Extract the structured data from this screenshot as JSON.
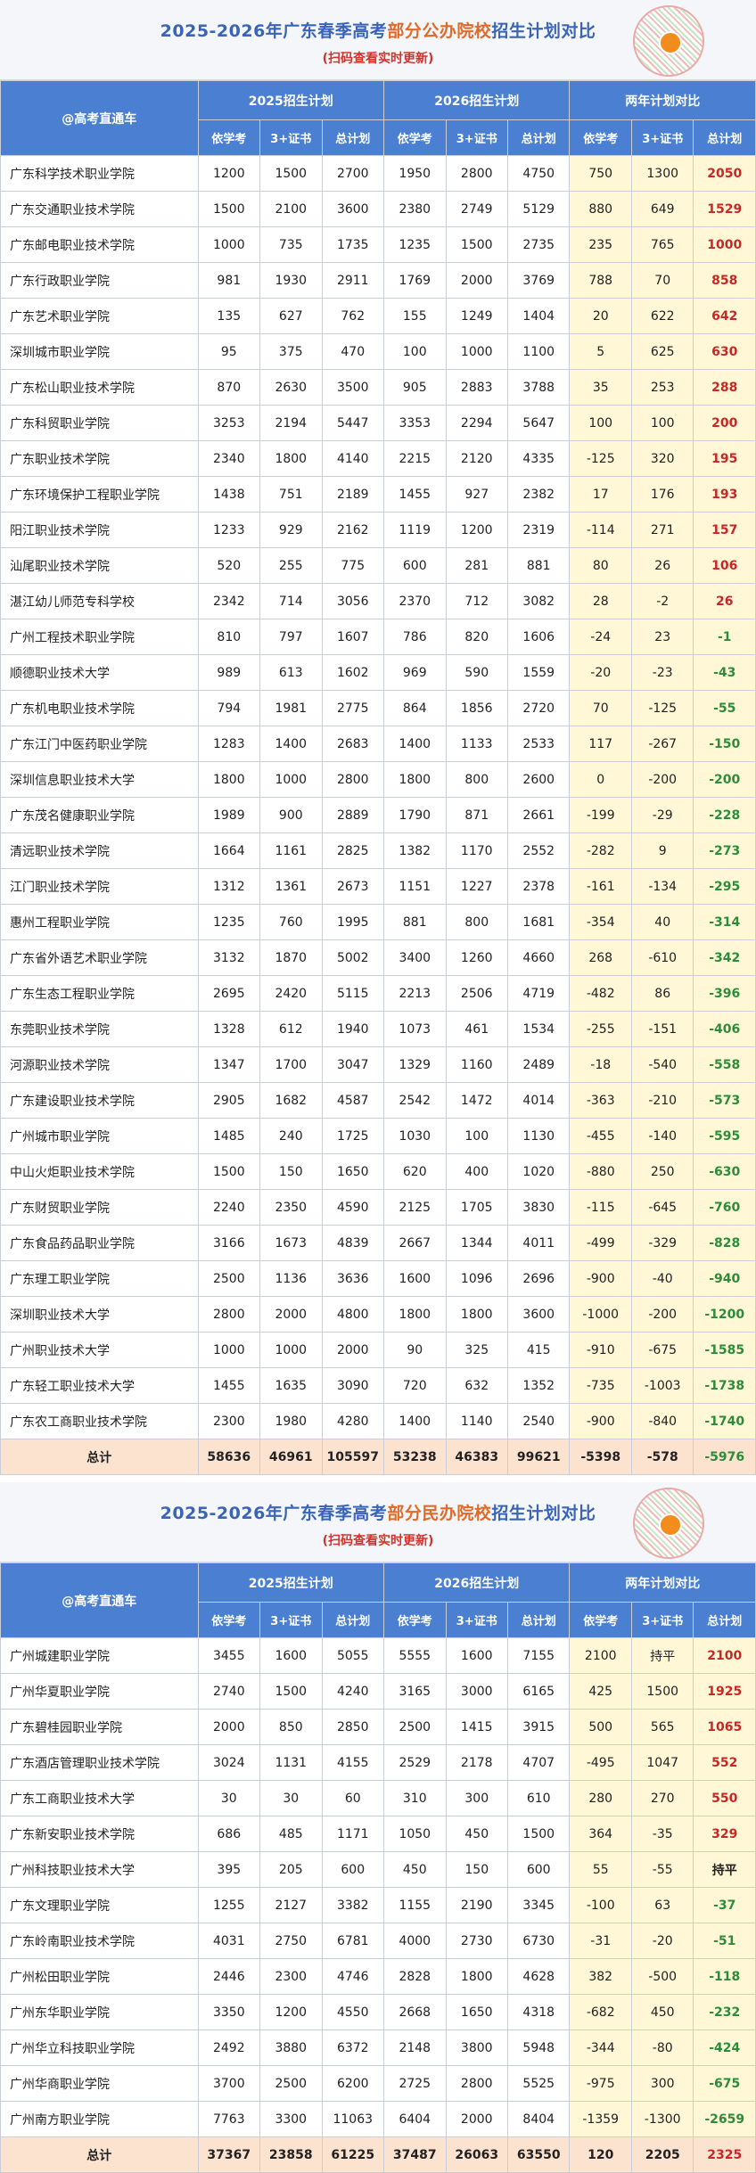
{
  "public": {
    "title_part1": "2025-2026年广东春季高考",
    "title_highlight": "部分公办院校",
    "title_part2": "招生计划对比",
    "subtitle": "(扫码查看实时更新)",
    "header": {
      "corner": "@高考直通车",
      "group_2025": "2025招生计划",
      "group_2026": "2026招生计划",
      "group_cmp": "两年计划对比",
      "sub": [
        "依学考",
        "3+证书",
        "总计划",
        "依学考",
        "3+证书",
        "总计划",
        "依学考",
        "3+证书",
        "总计划"
      ]
    },
    "rows": [
      {
        "name": "广东科学技术职业学院",
        "v": [
          "1200",
          "1500",
          "2700",
          "1950",
          "2800",
          "4750",
          "750",
          "1300",
          "2050"
        ]
      },
      {
        "name": "广东交通职业技术学院",
        "v": [
          "1500",
          "2100",
          "3600",
          "2380",
          "2749",
          "5129",
          "880",
          "649",
          "1529"
        ]
      },
      {
        "name": "广东邮电职业技术学院",
        "v": [
          "1000",
          "735",
          "1735",
          "1235",
          "1500",
          "2735",
          "235",
          "765",
          "1000"
        ]
      },
      {
        "name": "广东行政职业学院",
        "v": [
          "981",
          "1930",
          "2911",
          "1769",
          "2000",
          "3769",
          "788",
          "70",
          "858"
        ]
      },
      {
        "name": "广东艺术职业学院",
        "v": [
          "135",
          "627",
          "762",
          "155",
          "1249",
          "1404",
          "20",
          "622",
          "642"
        ]
      },
      {
        "name": "深圳城市职业学院",
        "v": [
          "95",
          "375",
          "470",
          "100",
          "1000",
          "1100",
          "5",
          "625",
          "630"
        ]
      },
      {
        "name": "广东松山职业技术学院",
        "v": [
          "870",
          "2630",
          "3500",
          "905",
          "2883",
          "3788",
          "35",
          "253",
          "288"
        ]
      },
      {
        "name": "广东科贸职业学院",
        "v": [
          "3253",
          "2194",
          "5447",
          "3353",
          "2294",
          "5647",
          "100",
          "100",
          "200"
        ]
      },
      {
        "name": "广东职业技术学院",
        "v": [
          "2340",
          "1800",
          "4140",
          "2215",
          "2120",
          "4335",
          "-125",
          "320",
          "195"
        ]
      },
      {
        "name": "广东环境保护工程职业学院",
        "v": [
          "1438",
          "751",
          "2189",
          "1455",
          "927",
          "2382",
          "17",
          "176",
          "193"
        ]
      },
      {
        "name": "阳江职业技术学院",
        "v": [
          "1233",
          "929",
          "2162",
          "1119",
          "1200",
          "2319",
          "-114",
          "271",
          "157"
        ]
      },
      {
        "name": "汕尾职业技术学院",
        "v": [
          "520",
          "255",
          "775",
          "600",
          "281",
          "881",
          "80",
          "26",
          "106"
        ]
      },
      {
        "name": "湛江幼儿师范专科学校",
        "v": [
          "2342",
          "714",
          "3056",
          "2370",
          "712",
          "3082",
          "28",
          "-2",
          "26"
        ]
      },
      {
        "name": "广州工程技术职业学院",
        "v": [
          "810",
          "797",
          "1607",
          "786",
          "820",
          "1606",
          "-24",
          "23",
          "-1"
        ]
      },
      {
        "name": "顺德职业技术大学",
        "v": [
          "989",
          "613",
          "1602",
          "969",
          "590",
          "1559",
          "-20",
          "-23",
          "-43"
        ]
      },
      {
        "name": "广东机电职业技术学院",
        "v": [
          "794",
          "1981",
          "2775",
          "864",
          "1856",
          "2720",
          "70",
          "-125",
          "-55"
        ]
      },
      {
        "name": "广东江门中医药职业学院",
        "v": [
          "1283",
          "1400",
          "2683",
          "1400",
          "1133",
          "2533",
          "117",
          "-267",
          "-150"
        ]
      },
      {
        "name": "深圳信息职业技术大学",
        "v": [
          "1800",
          "1000",
          "2800",
          "1800",
          "800",
          "2600",
          "0",
          "-200",
          "-200"
        ]
      },
      {
        "name": "广东茂名健康职业学院",
        "v": [
          "1989",
          "900",
          "2889",
          "1790",
          "871",
          "2661",
          "-199",
          "-29",
          "-228"
        ]
      },
      {
        "name": "清远职业技术学院",
        "v": [
          "1664",
          "1161",
          "2825",
          "1382",
          "1170",
          "2552",
          "-282",
          "9",
          "-273"
        ]
      },
      {
        "name": "江门职业技术学院",
        "v": [
          "1312",
          "1361",
          "2673",
          "1151",
          "1227",
          "2378",
          "-161",
          "-134",
          "-295"
        ]
      },
      {
        "name": "惠州工程职业学院",
        "v": [
          "1235",
          "760",
          "1995",
          "881",
          "800",
          "1681",
          "-354",
          "40",
          "-314"
        ]
      },
      {
        "name": "广东省外语艺术职业学院",
        "v": [
          "3132",
          "1870",
          "5002",
          "3400",
          "1260",
          "4660",
          "268",
          "-610",
          "-342"
        ]
      },
      {
        "name": "广东生态工程职业学院",
        "v": [
          "2695",
          "2420",
          "5115",
          "2213",
          "2506",
          "4719",
          "-482",
          "86",
          "-396"
        ]
      },
      {
        "name": "东莞职业技术学院",
        "v": [
          "1328",
          "612",
          "1940",
          "1073",
          "461",
          "1534",
          "-255",
          "-151",
          "-406"
        ]
      },
      {
        "name": "河源职业技术学院",
        "v": [
          "1347",
          "1700",
          "3047",
          "1329",
          "1160",
          "2489",
          "-18",
          "-540",
          "-558"
        ]
      },
      {
        "name": "广东建设职业技术学院",
        "v": [
          "2905",
          "1682",
          "4587",
          "2542",
          "1472",
          "4014",
          "-363",
          "-210",
          "-573"
        ]
      },
      {
        "name": "广州城市职业学院",
        "v": [
          "1485",
          "240",
          "1725",
          "1030",
          "100",
          "1130",
          "-455",
          "-140",
          "-595"
        ]
      },
      {
        "name": "中山火炬职业技术学院",
        "v": [
          "1500",
          "150",
          "1650",
          "620",
          "400",
          "1020",
          "-880",
          "250",
          "-630"
        ]
      },
      {
        "name": "广东财贸职业学院",
        "v": [
          "2240",
          "2350",
          "4590",
          "2125",
          "1705",
          "3830",
          "-115",
          "-645",
          "-760"
        ]
      },
      {
        "name": "广东食品药品职业学院",
        "v": [
          "3166",
          "1673",
          "4839",
          "2667",
          "1344",
          "4011",
          "-499",
          "-329",
          "-828"
        ]
      },
      {
        "name": "广东理工职业学院",
        "v": [
          "2500",
          "1136",
          "3636",
          "1600",
          "1096",
          "2696",
          "-900",
          "-40",
          "-940"
        ]
      },
      {
        "name": "深圳职业技术大学",
        "v": [
          "2800",
          "2000",
          "4800",
          "1800",
          "1800",
          "3600",
          "-1000",
          "-200",
          "-1200"
        ]
      },
      {
        "name": "广州职业技术大学",
        "v": [
          "1000",
          "1000",
          "2000",
          "90",
          "325",
          "415",
          "-910",
          "-675",
          "-1585"
        ]
      },
      {
        "name": "广东轻工职业技术大学",
        "v": [
          "1455",
          "1635",
          "3090",
          "720",
          "632",
          "1352",
          "-735",
          "-1003",
          "-1738"
        ]
      },
      {
        "name": "广东农工商职业技术学院",
        "v": [
          "2300",
          "1980",
          "4280",
          "1400",
          "1140",
          "2540",
          "-900",
          "-840",
          "-1740"
        ]
      }
    ],
    "total": {
      "name": "总计",
      "v": [
        "58636",
        "46961",
        "105597",
        "53238",
        "46383",
        "99621",
        "-5398",
        "-578",
        "-5976"
      ]
    }
  },
  "private": {
    "title_part1": "2025-2026年广东春季高考",
    "title_highlight": "部分民办院校",
    "title_part2": "招生计划对比",
    "subtitle": "(扫码查看实时更新)",
    "header": {
      "corner": "@高考直通车",
      "group_2025": "2025招生计划",
      "group_2026": "2026招生计划",
      "group_cmp": "两年计划对比",
      "sub": [
        "依学考",
        "3+证书",
        "总计划",
        "依学考",
        "3+证书",
        "总计划",
        "依学考",
        "3+证书",
        "总计划"
      ]
    },
    "rows": [
      {
        "name": "广州城建职业学院",
        "v": [
          "3455",
          "1600",
          "5055",
          "5555",
          "1600",
          "7155",
          "2100",
          "持平",
          "2100"
        ]
      },
      {
        "name": "广州华夏职业学院",
        "v": [
          "2740",
          "1500",
          "4240",
          "3165",
          "3000",
          "6165",
          "425",
          "1500",
          "1925"
        ]
      },
      {
        "name": "广东碧桂园职业学院",
        "v": [
          "2000",
          "850",
          "2850",
          "2500",
          "1415",
          "3915",
          "500",
          "565",
          "1065"
        ]
      },
      {
        "name": "广东酒店管理职业技术学院",
        "v": [
          "3024",
          "1131",
          "4155",
          "2529",
          "2178",
          "4707",
          "-495",
          "1047",
          "552"
        ]
      },
      {
        "name": "广东工商职业技术大学",
        "v": [
          "30",
          "30",
          "60",
          "310",
          "300",
          "610",
          "280",
          "270",
          "550"
        ]
      },
      {
        "name": "广东新安职业技术学院",
        "v": [
          "686",
          "485",
          "1171",
          "1050",
          "450",
          "1500",
          "364",
          "-35",
          "329"
        ]
      },
      {
        "name": "广州科技职业技术大学",
        "v": [
          "395",
          "205",
          "600",
          "450",
          "150",
          "600",
          "55",
          "-55",
          "持平"
        ]
      },
      {
        "name": "广东文理职业学院",
        "v": [
          "1255",
          "2127",
          "3382",
          "1155",
          "2190",
          "3345",
          "-100",
          "63",
          "-37"
        ]
      },
      {
        "name": "广东岭南职业技术学院",
        "v": [
          "4031",
          "2750",
          "6781",
          "4000",
          "2730",
          "6730",
          "-31",
          "-20",
          "-51"
        ]
      },
      {
        "name": "广州松田职业学院",
        "v": [
          "2446",
          "2300",
          "4746",
          "2828",
          "1800",
          "4628",
          "382",
          "-500",
          "-118"
        ]
      },
      {
        "name": "广州东华职业学院",
        "v": [
          "3350",
          "1200",
          "4550",
          "2668",
          "1650",
          "4318",
          "-682",
          "450",
          "-232"
        ]
      },
      {
        "name": "广州华立科技职业学院",
        "v": [
          "2492",
          "3880",
          "6372",
          "2148",
          "3800",
          "5948",
          "-344",
          "-80",
          "-424"
        ]
      },
      {
        "name": "广州华商职业学院",
        "v": [
          "3700",
          "2500",
          "6200",
          "2725",
          "2800",
          "5525",
          "-975",
          "300",
          "-675"
        ]
      },
      {
        "name": "广州南方职业学院",
        "v": [
          "7763",
          "3300",
          "11063",
          "6404",
          "2000",
          "8404",
          "-1359",
          "-1300",
          "-2659"
        ]
      }
    ],
    "total": {
      "name": "总计",
      "v": [
        "37367",
        "23858",
        "61225",
        "37487",
        "26063",
        "63550",
        "120",
        "2205",
        "2325"
      ]
    }
  },
  "colors": {
    "header_blue": "#4a7fd1",
    "cmp_bg": "#fff7d6",
    "positive": "#c62828",
    "negative": "#2e8b3a",
    "total_bg": "#fbe3cf"
  }
}
